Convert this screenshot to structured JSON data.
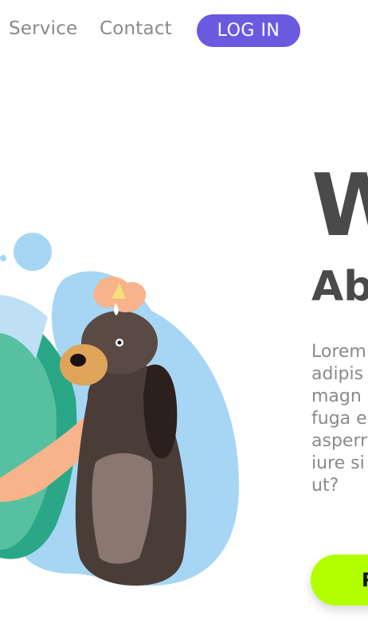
{
  "nav": {
    "links": [
      "Service",
      "Contact"
    ],
    "login_label": "LOG IN"
  },
  "hero": {
    "title": "W",
    "subtitle": "Ab",
    "body_lines": [
      "Lorem",
      "adipis",
      "magn",
      "fuga e",
      "asperr",
      "iure si",
      "ut?"
    ],
    "cta_label": "R"
  },
  "colors": {
    "accent": "#6a5ae0",
    "cta": "#b2ff00",
    "heading": "#4a4a4a",
    "text": "#8a8a8a"
  },
  "illustration": {
    "icon": "vet-dog-illustration"
  }
}
